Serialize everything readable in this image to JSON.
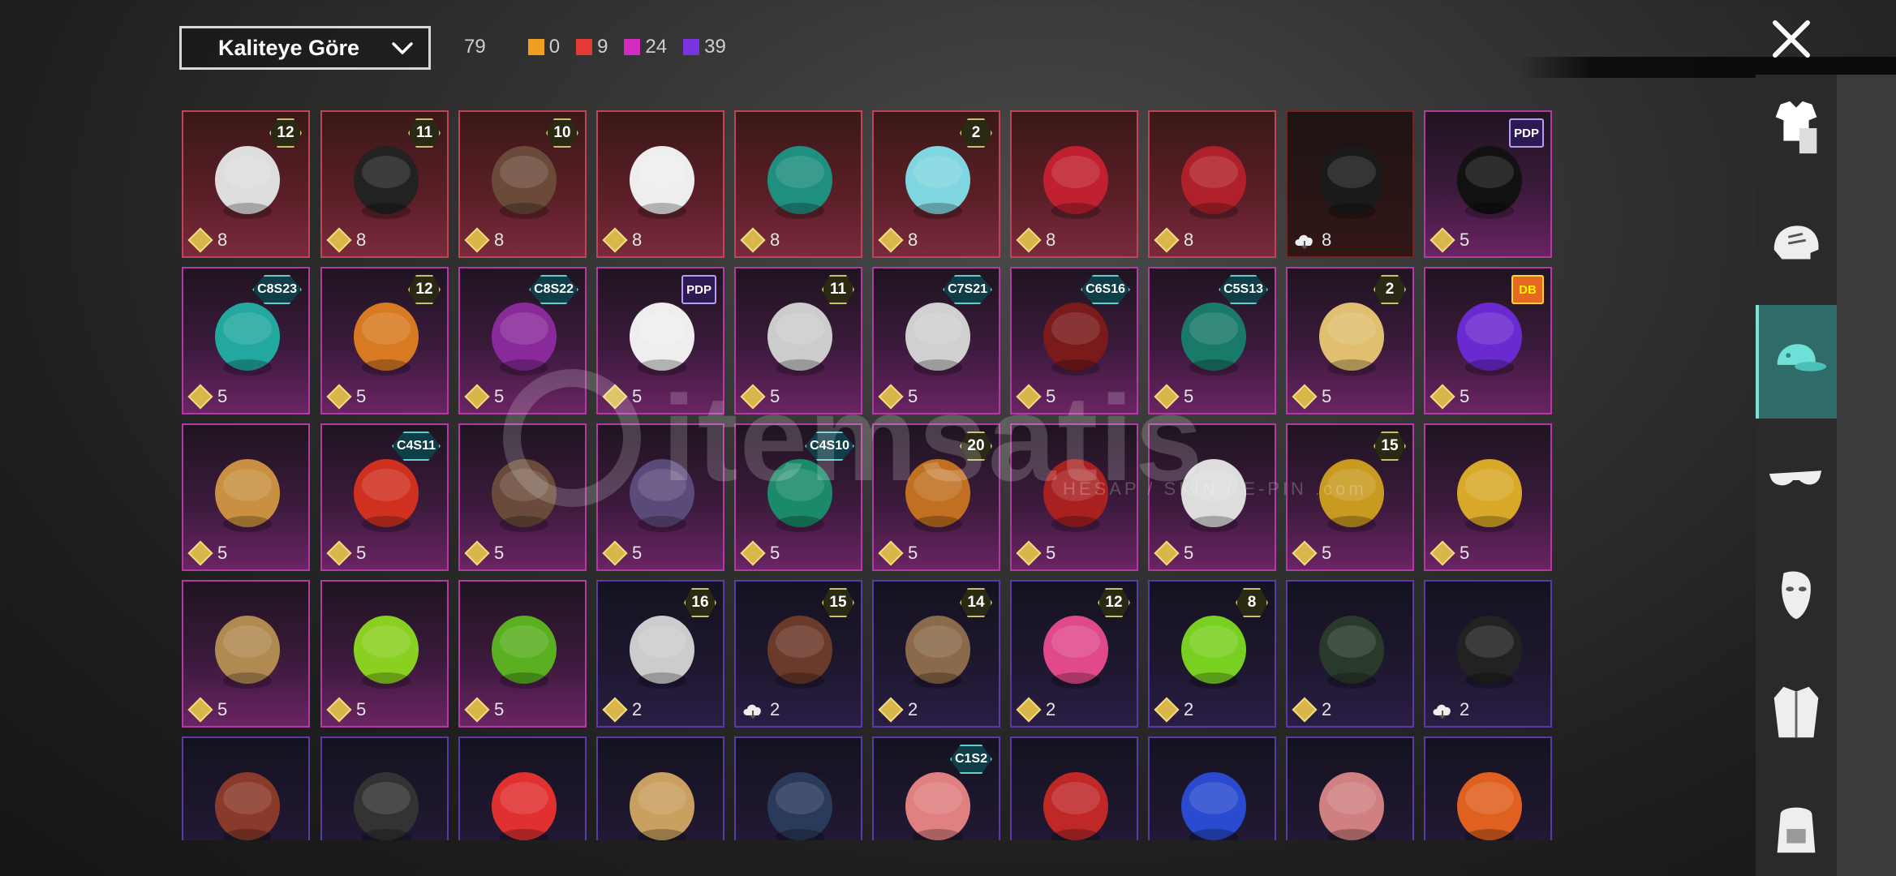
{
  "filter": {
    "sort_label": "Kaliteye Göre",
    "total_count": "79",
    "quality_counts": [
      {
        "color": "#f0a020",
        "count": "0"
      },
      {
        "color": "#e53935",
        "count": "9"
      },
      {
        "color": "#d22bc2",
        "count": "24"
      },
      {
        "color": "#7a33e0",
        "count": "39"
      }
    ]
  },
  "sidebar": {
    "tabs": [
      {
        "name": "outfit-icon",
        "active": false
      },
      {
        "name": "helmet-icon",
        "active": false
      },
      {
        "name": "hat-icon",
        "active": true
      },
      {
        "name": "glasses-icon",
        "active": false
      },
      {
        "name": "mask-icon",
        "active": false
      },
      {
        "name": "jacket-icon",
        "active": false
      },
      {
        "name": "backpack-icon",
        "active": false
      }
    ]
  },
  "watermark": {
    "brand": "itemsatis",
    "tagline": "HESAP / SKIN / E-PIN .com"
  },
  "items": [
    {
      "tier": "red",
      "badge": "12",
      "badge_type": "level",
      "qty": "8",
      "icon": "diamond",
      "art": "white-twin-tail-hair",
      "color": "#ddd"
    },
    {
      "tier": "red",
      "badge": "11",
      "badge_type": "level",
      "qty": "8",
      "icon": "diamond",
      "art": "black-short-hair",
      "color": "#222"
    },
    {
      "tier": "red",
      "badge": "10",
      "badge_type": "level",
      "qty": "8",
      "icon": "diamond",
      "art": "brown-long-hair",
      "color": "#6b4a3a"
    },
    {
      "tier": "red",
      "badge": "",
      "badge_type": "",
      "qty": "8",
      "icon": "diamond",
      "art": "white-cowboy-hat",
      "color": "#eee"
    },
    {
      "tier": "red",
      "badge": "",
      "badge_type": "",
      "qty": "8",
      "icon": "diamond",
      "art": "teal-dragon-helmet",
      "color": "#1f8f80"
    },
    {
      "tier": "red",
      "badge": "2",
      "badge_type": "level",
      "qty": "8",
      "icon": "diamond",
      "art": "cyan-bucket-hat",
      "color": "#7fd6e0"
    },
    {
      "tier": "red",
      "badge": "",
      "badge_type": "",
      "qty": "8",
      "icon": "diamond",
      "art": "red-fox-mask-hat",
      "color": "#c02030"
    },
    {
      "tier": "red",
      "badge": "",
      "badge_type": "",
      "qty": "8",
      "icon": "diamond",
      "art": "red-visor-helmet",
      "color": "#b0202a"
    },
    {
      "tier": "dark",
      "badge": "",
      "badge_type": "",
      "qty": "8",
      "icon": "cloud",
      "art": "black-horned-helmet",
      "color": "#1a1a1a"
    },
    {
      "tier": "purple",
      "badge": "PDP",
      "badge_type": "logo",
      "qty": "5",
      "icon": "diamond",
      "art": "black-curly-hair",
      "color": "#111"
    },
    {
      "tier": "purple",
      "badge": "C8S23",
      "badge_type": "season",
      "qty": "5",
      "icon": "diamond",
      "art": "cat-ear-headphones",
      "color": "#23a8a0"
    },
    {
      "tier": "purple",
      "badge": "12",
      "badge_type": "level",
      "qty": "5",
      "icon": "diamond",
      "art": "orange-pigtail-hair",
      "color": "#d87a22"
    },
    {
      "tier": "purple",
      "badge": "C8S22",
      "badge_type": "season",
      "qty": "5",
      "icon": "diamond",
      "art": "purple-short-hair",
      "color": "#8a2a9a"
    },
    {
      "tier": "purple",
      "badge": "PDP",
      "badge_type": "logo",
      "qty": "5",
      "icon": "diamond",
      "art": "panda-head-mask",
      "color": "#eee"
    },
    {
      "tier": "purple",
      "badge": "11",
      "badge_type": "level",
      "qty": "5",
      "icon": "diamond",
      "art": "flower-veil-hat",
      "color": "#ccc"
    },
    {
      "tier": "purple",
      "badge": "C7S21",
      "badge_type": "season",
      "qty": "5",
      "icon": "diamond",
      "art": "silver-hair",
      "color": "#d0d0d0"
    },
    {
      "tier": "purple",
      "badge": "C6S16",
      "badge_type": "season",
      "qty": "5",
      "icon": "diamond",
      "art": "red-bob-hair",
      "color": "#7a1a1a"
    },
    {
      "tier": "purple",
      "badge": "C5S13",
      "badge_type": "season",
      "qty": "5",
      "icon": "diamond",
      "art": "green-fish-hat",
      "color": "#1a7a6a"
    },
    {
      "tier": "purple",
      "badge": "2",
      "badge_type": "level",
      "qty": "5",
      "icon": "diamond",
      "art": "blonde-beret-hair",
      "color": "#e0c070"
    },
    {
      "tier": "purple",
      "badge": "DB",
      "badge_type": "dbz",
      "qty": "5",
      "icon": "diamond",
      "art": "purple-visor-helmet",
      "color": "#6a2ad0"
    },
    {
      "tier": "purple",
      "badge": "",
      "badge_type": "",
      "qty": "5",
      "icon": "diamond",
      "art": "potato-head-mask",
      "color": "#c89040"
    },
    {
      "tier": "purple",
      "badge": "C4S11",
      "badge_type": "season",
      "qty": "5",
      "icon": "diamond",
      "art": "red-cap",
      "color": "#d03020"
    },
    {
      "tier": "purple",
      "badge": "",
      "badge_type": "",
      "qty": "5",
      "icon": "diamond",
      "art": "brown-bow-long-hair",
      "color": "#6a4a3a"
    },
    {
      "tier": "purple",
      "badge": "",
      "badge_type": "",
      "qty": "5",
      "icon": "diamond",
      "art": "bunny-ear-headphones",
      "color": "#5a4a7a"
    },
    {
      "tier": "purple",
      "badge": "C4S10",
      "badge_type": "season",
      "qty": "5",
      "icon": "diamond",
      "art": "green-spiked-helmet",
      "color": "#1a8a6a"
    },
    {
      "tier": "purple",
      "badge": "20",
      "badge_type": "level",
      "qty": "5",
      "icon": "diamond",
      "art": "monkey-king-mask",
      "color": "#c07020"
    },
    {
      "tier": "purple",
      "badge": "",
      "badge_type": "",
      "qty": "5",
      "icon": "diamond",
      "art": "red-bun-hair",
      "color": "#a82020"
    },
    {
      "tier": "purple",
      "badge": "",
      "badge_type": "",
      "qty": "5",
      "icon": "diamond",
      "art": "crown-white-hair",
      "color": "#ddd"
    },
    {
      "tier": "purple",
      "badge": "15",
      "badge_type": "level",
      "qty": "5",
      "icon": "diamond",
      "art": "gold-knight-helmet",
      "color": "#c99a20"
    },
    {
      "tier": "purple",
      "badge": "",
      "badge_type": "",
      "qty": "5",
      "icon": "diamond",
      "art": "gold-crown-mask",
      "color": "#d9a92a"
    },
    {
      "tier": "purple",
      "badge": "",
      "badge_type": "",
      "qty": "5",
      "icon": "diamond",
      "art": "straw-nest-hat",
      "color": "#b08a50"
    },
    {
      "tier": "purple",
      "badge": "",
      "badge_type": "",
      "qty": "5",
      "icon": "diamond",
      "art": "green-frog-chainsaw-mask",
      "color": "#8ad020"
    },
    {
      "tier": "purple",
      "badge": "",
      "badge_type": "",
      "qty": "5",
      "icon": "diamond",
      "art": "green-braid-hair",
      "color": "#5ab020"
    },
    {
      "tier": "violet",
      "badge": "16",
      "badge_type": "level",
      "qty": "2",
      "icon": "diamond",
      "art": "pattern-beanie-goggles",
      "color": "#ccc"
    },
    {
      "tier": "violet",
      "badge": "15",
      "badge_type": "level",
      "qty": "2",
      "icon": "cloud",
      "art": "brown-hooded-hair",
      "color": "#6a3a2a"
    },
    {
      "tier": "violet",
      "badge": "14",
      "badge_type": "level",
      "qty": "2",
      "icon": "diamond",
      "art": "blue-cap-long-hair",
      "color": "#8a6a4a"
    },
    {
      "tier": "violet",
      "badge": "12",
      "badge_type": "level",
      "qty": "2",
      "icon": "diamond",
      "art": "bunny-ear-helmet",
      "color": "#e04a8a"
    },
    {
      "tier": "violet",
      "badge": "8",
      "badge_type": "level",
      "qty": "2",
      "icon": "diamond",
      "art": "skull-dark-hair",
      "color": "#7ad020"
    },
    {
      "tier": "violet",
      "badge": "",
      "badge_type": "",
      "qty": "2",
      "icon": "diamond",
      "art": "gas-mask-helmet",
      "color": "#2a3a2a"
    },
    {
      "tier": "violet",
      "badge": "",
      "badge_type": "",
      "qty": "2",
      "icon": "cloud",
      "art": "black-motor-helmet",
      "color": "#222"
    },
    {
      "tier": "violet",
      "badge": "",
      "badge_type": "",
      "qty": "",
      "icon": "",
      "art": "goggle-brown-hair",
      "color": "#8a3a2a"
    },
    {
      "tier": "violet",
      "badge": "",
      "badge_type": "",
      "qty": "",
      "icon": "",
      "art": "black-cap",
      "color": "#333"
    },
    {
      "tier": "violet",
      "badge": "",
      "badge_type": "",
      "qty": "",
      "icon": "",
      "art": "red-white-cap",
      "color": "#e03030"
    },
    {
      "tier": "violet",
      "badge": "",
      "badge_type": "",
      "qty": "",
      "icon": "",
      "art": "blonde-long-hair",
      "color": "#c9a060"
    },
    {
      "tier": "violet",
      "badge": "",
      "badge_type": "",
      "qty": "",
      "icon": "",
      "art": "navy-beanie",
      "color": "#2a3a5a"
    },
    {
      "tier": "violet",
      "badge": "C1S2",
      "badge_type": "season",
      "qty": "",
      "icon": "",
      "art": "pink-bandana",
      "color": "#e08080"
    },
    {
      "tier": "violet",
      "badge": "",
      "badge_type": "",
      "qty": "",
      "icon": "",
      "art": "red-football-helmet",
      "color": "#c02828"
    },
    {
      "tier": "violet",
      "badge": "",
      "badge_type": "",
      "qty": "",
      "icon": "",
      "art": "blue-cricket-helmet",
      "color": "#2a4ad0"
    },
    {
      "tier": "violet",
      "badge": "",
      "badge_type": "",
      "qty": "",
      "icon": "",
      "art": "pink-bun-hair",
      "color": "#d08080"
    },
    {
      "tier": "violet",
      "badge": "",
      "badge_type": "",
      "qty": "",
      "icon": "",
      "art": "orange-visor-helmet",
      "color": "#e06020"
    }
  ]
}
